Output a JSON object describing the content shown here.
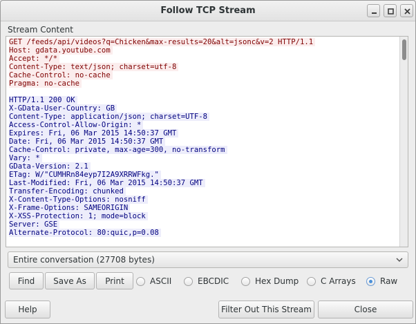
{
  "window": {
    "title": "Follow TCP Stream"
  },
  "stream": {
    "label": "Stream Content",
    "client_lines": [
      "GET /feeds/api/videos?q=Chicken&max-results=20&alt=jsonc&v=2 HTTP/1.1",
      "Host: gdata.youtube.com",
      "Accept: */*",
      "Content-Type: text/json; charset=utf-8",
      "Cache-Control: no-cache",
      "Pragma: no-cache"
    ],
    "server_lines": [
      "HTTP/1.1 200 OK",
      "X-GData-User-Country: GB",
      "Content-Type: application/json; charset=UTF-8",
      "Access-Control-Allow-Origin: *",
      "Expires: Fri, 06 Mar 2015 14:50:37 GMT",
      "Date: Fri, 06 Mar 2015 14:50:37 GMT",
      "Cache-Control: private, max-age=300, no-transform",
      "Vary: *",
      "GData-Version: 2.1",
      "ETag: W/\"CUMHRn84eyp7I2A9XRRWFkg.\"",
      "Last-Modified: Fri, 06 Mar 2015 14:50:37 GMT",
      "Transfer-Encoding: chunked",
      "X-Content-Type-Options: nosniff",
      "X-Frame-Options: SAMEORIGIN",
      "X-XSS-Protection: 1; mode=block",
      "Server: GSE",
      "Alternate-Protocol: 80:quic,p=0.08"
    ],
    "scroll_fraction": 0.0
  },
  "conversation_select": {
    "value": "Entire conversation (27708 bytes)"
  },
  "actions": {
    "find": "Find",
    "save_as": "Save As",
    "print": "Print"
  },
  "format_options": [
    {
      "label": "ASCII",
      "selected": false
    },
    {
      "label": "EBCDIC",
      "selected": false
    },
    {
      "label": "Hex Dump",
      "selected": false
    },
    {
      "label": "C Arrays",
      "selected": false
    },
    {
      "label": "Raw",
      "selected": true
    }
  ],
  "footer": {
    "help": "Help",
    "filter_out": "Filter Out This Stream",
    "close": "Close"
  },
  "colors": {
    "client_text": "#7f0000",
    "client_bg": "#fbeded",
    "server_text": "#00007f",
    "server_bg": "#ededfb",
    "radio_accent": "#4a90d9"
  },
  "icons": [
    "minimize-icon",
    "maximize-icon",
    "close-icon",
    "chevron-down-icon"
  ]
}
